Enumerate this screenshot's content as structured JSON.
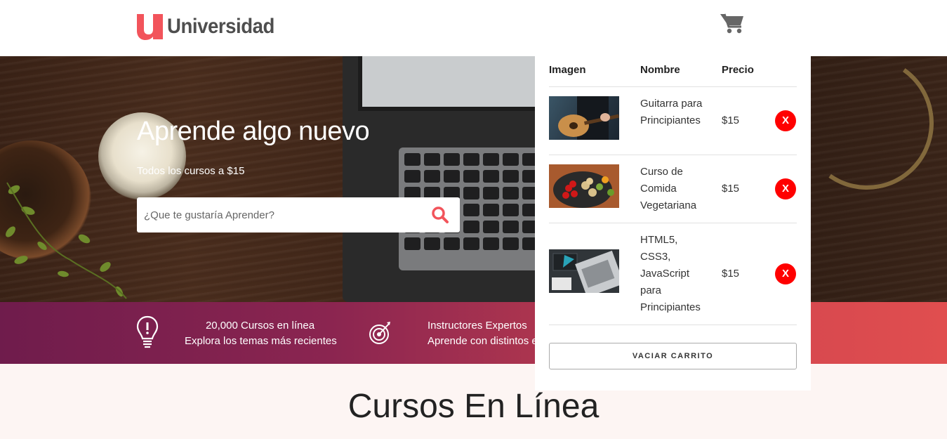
{
  "header": {
    "logo_text": "Universidad",
    "cart_icon": "shopping-cart-icon"
  },
  "hero": {
    "title": "Aprende algo nuevo",
    "subtitle": "Todos los cursos a $15",
    "search": {
      "placeholder": "¿Que te gustaría Aprender?",
      "value": "",
      "icon": "search-icon"
    }
  },
  "features": [
    {
      "icon": "lightbulb-icon",
      "line1": "20,000 Cursos en línea",
      "line2": "Explora los temas más recientes"
    },
    {
      "icon": "target-icon",
      "line1": "Instructores Expertos",
      "line2": "Aprende con distintos estilos"
    }
  ],
  "cursos": {
    "title": "Cursos En Línea"
  },
  "cart": {
    "columns": {
      "image": "Imagen",
      "name": "Nombre",
      "price": "Precio"
    },
    "items": [
      {
        "name": "Guitarra para Principiantes",
        "price": "$15",
        "remove": "X",
        "image": "guitar-course-image"
      },
      {
        "name": "Curso de Comida Vegetariana",
        "price": "$15",
        "remove": "X",
        "image": "vegetarian-food-image"
      },
      {
        "name": "HTML5, CSS3, JavaScript para Principiantes",
        "price": "$15",
        "remove": "X",
        "image": "web-dev-laptop-image"
      }
    ],
    "empty_button": "VACIAR CARRITO"
  },
  "colors": {
    "brand_red": "#f2545b",
    "bar_start": "#6f1c4c",
    "bar_end": "#e04e4f",
    "remove_red": "#ff0000",
    "text_dark": "#222222"
  }
}
